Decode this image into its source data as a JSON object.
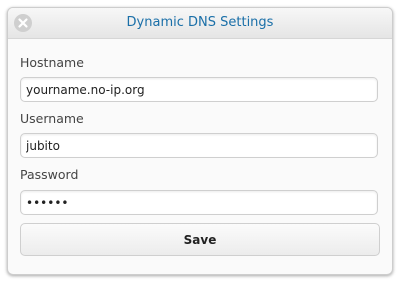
{
  "dialog": {
    "title": "Dynamic DNS Settings",
    "close_icon": "close-circle-icon"
  },
  "form": {
    "hostname_label": "Hostname",
    "hostname_value": "yourname.no-ip.org",
    "username_label": "Username",
    "username_value": "jubito",
    "password_label": "Password",
    "password_value": "secret",
    "save_label": "Save"
  },
  "colors": {
    "title_text": "#1a6fa8",
    "close_icon_bg": "#cfcfcf"
  }
}
